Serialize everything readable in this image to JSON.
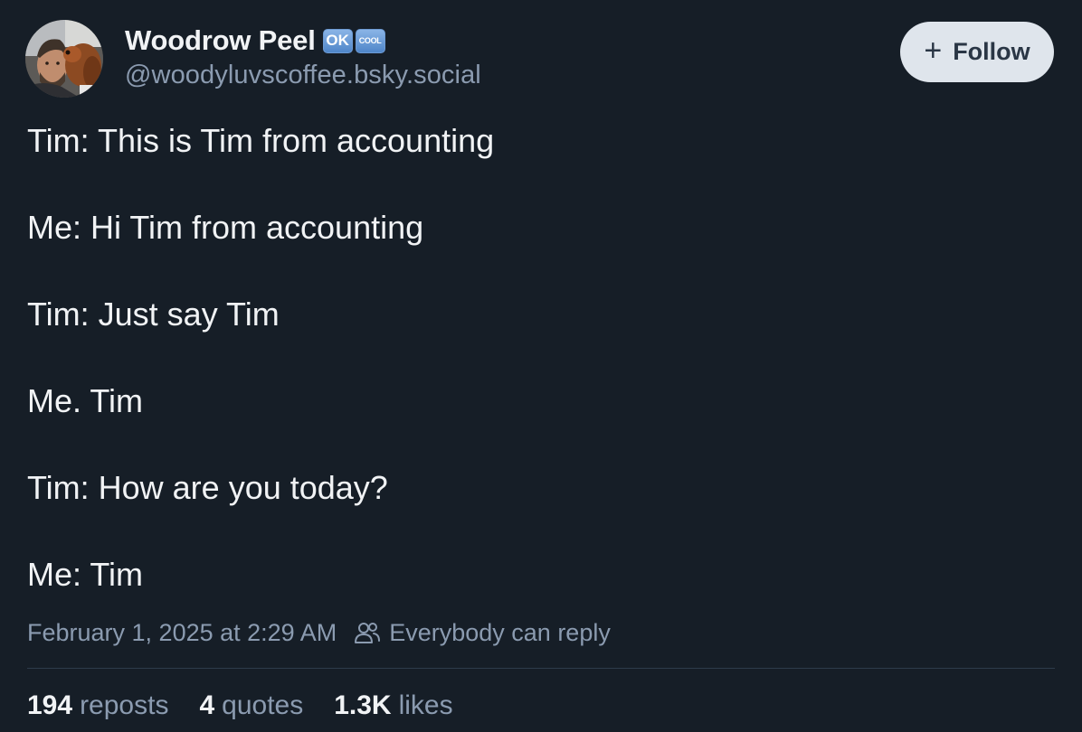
{
  "author": {
    "display_name": "Woodrow Peel",
    "badges": [
      "OK",
      "COOL"
    ],
    "handle": "@woodyluvscoffee.bsky.social",
    "avatar_icon": "avatar-man-with-dog"
  },
  "follow_button": {
    "icon": "plus-icon",
    "plus": "+",
    "label": "Follow"
  },
  "post": {
    "lines": [
      "Tim: This is Tim from accounting",
      "Me: Hi Tim from accounting",
      "Tim: Just say Tim",
      "Me. Tim",
      "Tim: How are you today?",
      "Me: Tim"
    ]
  },
  "meta": {
    "timestamp": "February 1, 2025 at 2:29 AM",
    "reply_icon": "people-icon",
    "reply_setting": "Everybody can reply"
  },
  "stats": {
    "reposts_count": "194",
    "reposts_label": "reposts",
    "quotes_count": "4",
    "quotes_label": "quotes",
    "likes_count": "1.3K",
    "likes_label": "likes"
  },
  "colors": {
    "background": "#161e27",
    "text": "#f1f3f5",
    "muted": "#8b9bb0",
    "follow_bg": "#dfe5ec",
    "badge": "#5b8fd0"
  }
}
